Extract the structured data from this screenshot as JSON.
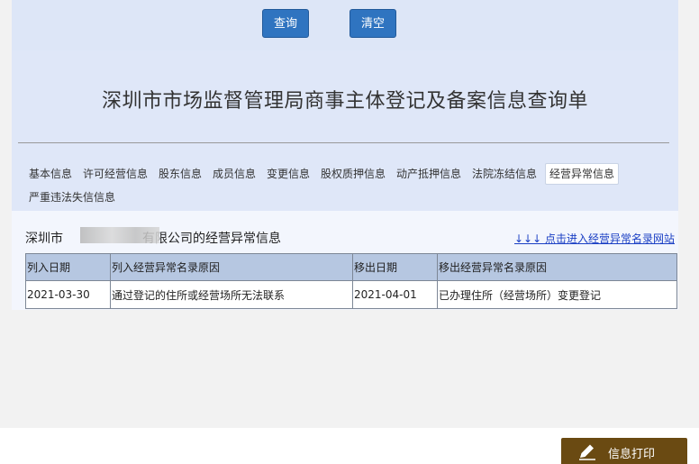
{
  "toolbar": {
    "query_label": "查询",
    "clear_label": "清空"
  },
  "page": {
    "title": "深圳市市场监督管理局商事主体登记及备案信息查询单"
  },
  "tabs": [
    {
      "label": "基本信息",
      "active": false
    },
    {
      "label": "许可经营信息",
      "active": false
    },
    {
      "label": "股东信息",
      "active": false
    },
    {
      "label": "成员信息",
      "active": false
    },
    {
      "label": "变更信息",
      "active": false
    },
    {
      "label": "股权质押信息",
      "active": false
    },
    {
      "label": "动产抵押信息",
      "active": false
    },
    {
      "label": "法院冻结信息",
      "active": false
    },
    {
      "label": "经营异常信息",
      "active": true
    },
    {
      "label": "严重违法失信信息",
      "active": false
    }
  ],
  "section": {
    "heading_prefix": "深圳市",
    "heading_suffix": "有限公司的经营异常信息",
    "link_text": "↓↓↓ 点击进入经营异常名录网站"
  },
  "table": {
    "headers": [
      "列入日期",
      "列入经营异常名录原因",
      "移出日期",
      "移出经营异常名录原因"
    ],
    "rows": [
      [
        "2021-03-30",
        "通过登记的住所或经营场所无法联系",
        "2021-04-01",
        "已办理住所（经营场所）变更登记"
      ]
    ]
  },
  "footer": {
    "print_label": "信息打印"
  },
  "colors": {
    "primary_button": "#2f74c0",
    "panel_bg": "#dfe7f8",
    "table_header_bg": "#b6c7e1",
    "link": "#1a3fc4",
    "print_button": "#6a4a12"
  }
}
